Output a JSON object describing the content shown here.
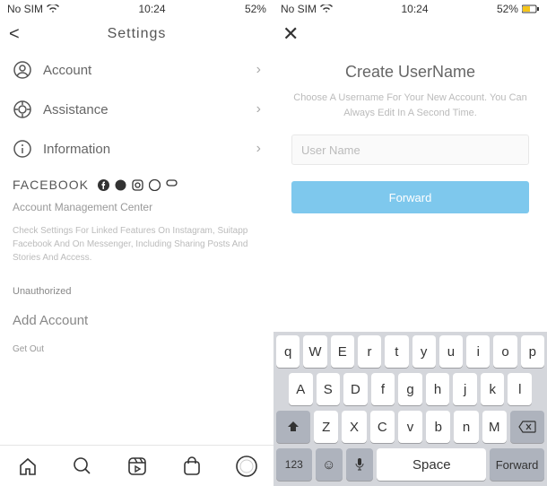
{
  "left": {
    "status": {
      "carrier": "No SIM",
      "time": "10:24",
      "battery": "52%"
    },
    "title": "Settings",
    "rows": [
      {
        "icon": "account",
        "label": "Account"
      },
      {
        "icon": "assistance",
        "label": "Assistance"
      },
      {
        "icon": "info",
        "label": "Information"
      }
    ],
    "fb": {
      "heading": "FACEBOOK"
    },
    "amc": "Account Management Center",
    "desc": "Check Settings For Linked Features On Instagram, Suitapp Facebook And On Messenger, Including Sharing Posts And Stories And Access.",
    "unauth": "Unauthorized",
    "add": "Add Account",
    "getout": "Get Out"
  },
  "right": {
    "status": {
      "carrier": "No SIM",
      "time": "10:24",
      "battery": "52%"
    },
    "title": "Create UserName",
    "sub": "Choose A Username For Your New Account. You Can Always Edit In A Second Time.",
    "placeholder": "User Name",
    "forward": "Forward",
    "kb": {
      "r1": [
        "q",
        "W",
        "E",
        "r",
        "t",
        "y",
        "u",
        "i",
        "o",
        "p"
      ],
      "r2": [
        "A",
        "S",
        "D",
        "f",
        "g",
        "h",
        "j",
        "k",
        "l"
      ],
      "r3": [
        "Z",
        "X",
        "C",
        "v",
        "b",
        "n",
        "M"
      ],
      "num": "123",
      "space": "Space",
      "fwd": "Forward"
    }
  }
}
